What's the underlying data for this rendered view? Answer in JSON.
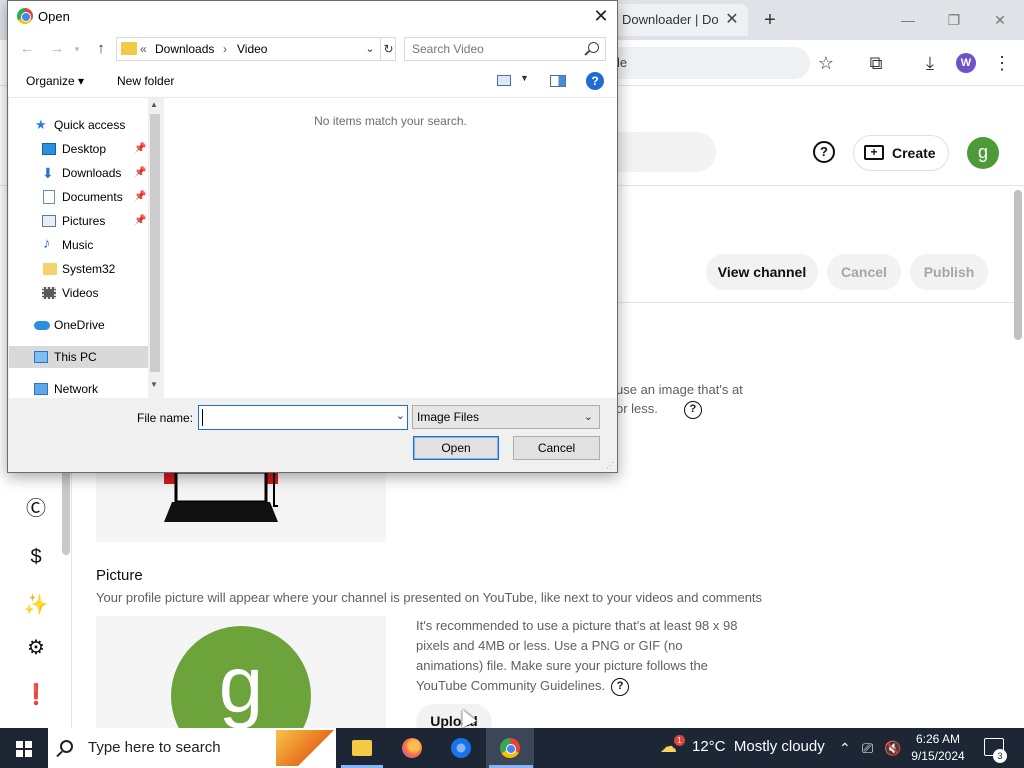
{
  "browser": {
    "tab_title": "Downloader | Do",
    "tab_close": "✕",
    "new_tab": "+",
    "minimize": "—",
    "restore": "❐",
    "close": "✕",
    "omnibox_text": "le",
    "star_icon": "☆",
    "extensions_icon": "⧉",
    "download_icon": "⤓",
    "profile_initial": "W",
    "menu_icon": "⋮"
  },
  "youtube": {
    "help_icon": "?",
    "create_label": "Create",
    "avatar_initial": "g",
    "view_channel": "View channel",
    "cancel": "Cancel",
    "publish": "Publish",
    "banner_text_line1": "use an image that's at",
    "banner_text_line2": "or less.",
    "picture_title": "Picture",
    "picture_description": "Your profile picture will appear where your channel is presented on YouTube, like next to your videos and comments",
    "picture_help": "It's recommended to use a picture that's at least 98 x 98 pixels and 4MB or less. Use a PNG or GIF (no animations) file. Make sure your picture follows the YouTube Community Guidelines.",
    "picture_avatar_initial": "g",
    "upload_label": "Upload",
    "nav_icons": [
      "Ⓒ",
      "$",
      "✨",
      "⚙",
      "❗"
    ]
  },
  "dialog": {
    "title": "Open",
    "close": "✕",
    "address": {
      "chevrons": "«",
      "segment1": "Downloads",
      "separator": "›",
      "segment2": "Video"
    },
    "search_placeholder": "Search Video",
    "organize_label": "Organize ▾",
    "new_folder_label": "New folder",
    "help_label": "?",
    "empty_message": "No items match your search.",
    "nav_items": [
      {
        "label": "Quick access",
        "icon": "star-icon",
        "pinned": false
      },
      {
        "label": "Desktop",
        "icon": "desktop-icon",
        "pinned": true
      },
      {
        "label": "Downloads",
        "icon": "download-arrow-icon",
        "pinned": true
      },
      {
        "label": "Documents",
        "icon": "document-icon",
        "pinned": true
      },
      {
        "label": "Pictures",
        "icon": "pictures-icon",
        "pinned": true
      },
      {
        "label": "Music",
        "icon": "music-icon",
        "pinned": false
      },
      {
        "label": "System32",
        "icon": "folder-icon",
        "pinned": false
      },
      {
        "label": "Videos",
        "icon": "video-icon",
        "pinned": false
      },
      {
        "label": "OneDrive",
        "icon": "cloud-icon",
        "pinned": false
      },
      {
        "label": "This PC",
        "icon": "computer-icon",
        "pinned": false,
        "selected": true
      },
      {
        "label": "Network",
        "icon": "network-icon",
        "pinned": false
      }
    ],
    "filename_label": "File name:",
    "filename_value": "",
    "filetype_value": "Image Files",
    "open_label": "Open",
    "cancel_label": "Cancel"
  },
  "taskbar": {
    "search_placeholder": "Type here to search",
    "weather_temp": "12°C",
    "weather_desc": "Mostly cloudy",
    "weather_badge": "1",
    "time": "6:26 AM",
    "date": "9/15/2024",
    "notification_count": "3"
  },
  "colors": {
    "accent": "#1f6dd1",
    "taskbar": "#1c2635",
    "youtube_avatar": "#4f9a38"
  }
}
